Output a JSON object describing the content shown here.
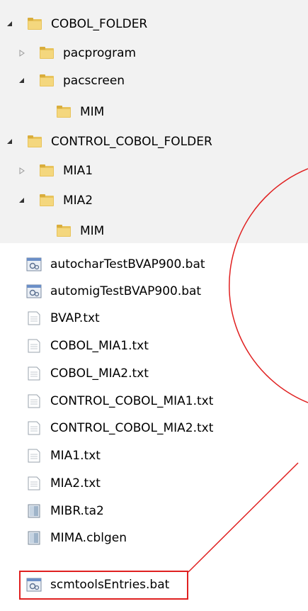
{
  "tree": [
    {
      "label": "COBOL_FOLDER",
      "type": "folder",
      "expander": "expanded",
      "depth": 0
    },
    {
      "label": "pacprogram",
      "type": "folder",
      "expander": "collapsed",
      "depth": 1
    },
    {
      "label": "pacscreen",
      "type": "folder",
      "expander": "expanded",
      "depth": 1
    },
    {
      "label": "MIM",
      "type": "folder",
      "expander": "none",
      "depth": 2
    },
    {
      "label": "CONTROL_COBOL_FOLDER",
      "type": "folder",
      "expander": "expanded",
      "depth": 0
    },
    {
      "label": "MIA1",
      "type": "folder",
      "expander": "collapsed",
      "depth": 1
    },
    {
      "label": "MIA2",
      "type": "folder",
      "expander": "expanded",
      "depth": 1
    },
    {
      "label": "MIM",
      "type": "folder",
      "expander": "none",
      "depth": 2
    }
  ],
  "files": [
    {
      "label": "autocharTestBVAP900.bat",
      "icon": "batch-file-icon"
    },
    {
      "label": "automigTestBVAP900.bat",
      "icon": "batch-file-icon"
    },
    {
      "label": "BVAP.txt",
      "icon": "text-file-icon"
    },
    {
      "label": "COBOL_MIA1.txt",
      "icon": "text-file-icon"
    },
    {
      "label": "COBOL_MIA2.txt",
      "icon": "text-file-icon"
    },
    {
      "label": "CONTROL_COBOL_MIA1.txt",
      "icon": "text-file-icon"
    },
    {
      "label": "CONTROL_COBOL_MIA2.txt",
      "icon": "text-file-icon"
    },
    {
      "label": "MIA1.txt",
      "icon": "text-file-icon"
    },
    {
      "label": "MIA2.txt",
      "icon": "text-file-icon"
    },
    {
      "label": "MIBR.ta2",
      "icon": "generic-file-icon"
    },
    {
      "label": "MIMA.cblgen",
      "icon": "generic-file-icon"
    },
    {
      "label": "scmtoolsEntries.bat",
      "icon": "batch-file-icon"
    }
  ],
  "colors": {
    "annotation": "#e02020"
  }
}
